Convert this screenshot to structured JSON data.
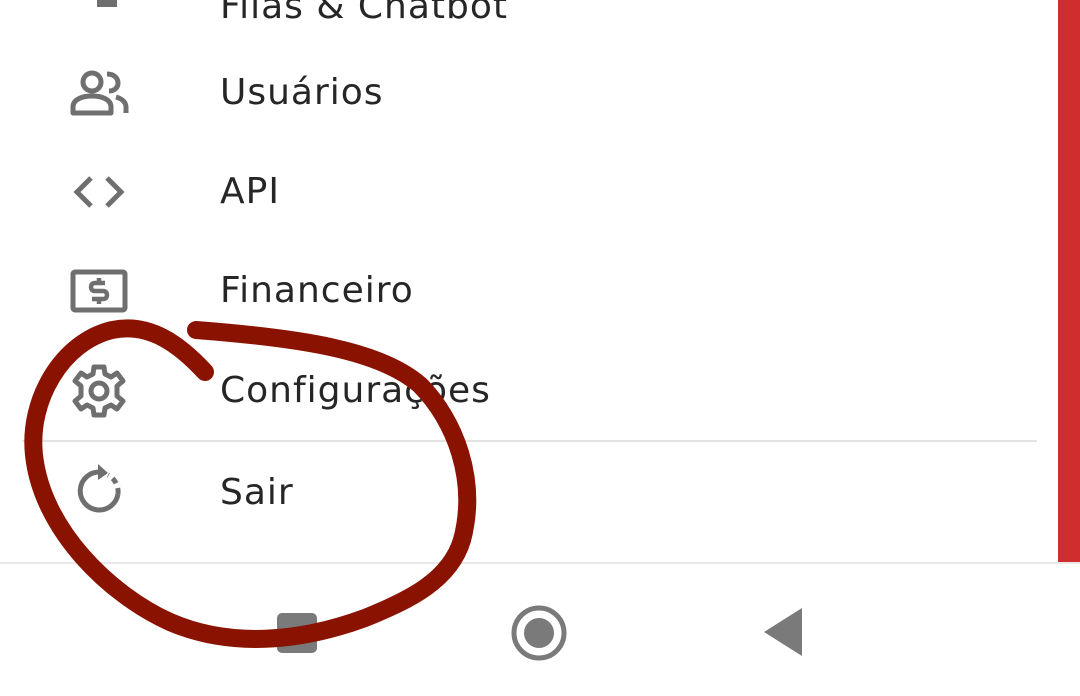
{
  "menu": {
    "items": [
      {
        "id": "filas",
        "label": "Filas & Chatbot",
        "icon": "queue-icon"
      },
      {
        "id": "usuarios",
        "label": "Usuários",
        "icon": "users-icon"
      },
      {
        "id": "api",
        "label": "API",
        "icon": "code-icon"
      },
      {
        "id": "financeiro",
        "label": "Financeiro",
        "icon": "dollar-icon"
      },
      {
        "id": "configuracoes",
        "label": "Configurações",
        "icon": "gear-icon"
      }
    ],
    "logout": {
      "label": "Sair",
      "icon": "refresh-dashed-icon"
    }
  },
  "nav_bar": {
    "buttons": [
      "recents-button",
      "home-button",
      "back-button"
    ]
  },
  "colors": {
    "icon_gray": "#6f6f6f",
    "label_text": "#262626",
    "accent_red_bar": "#d02e2e",
    "annotation_ink": "#8a1200",
    "divider": "#e3e3e3"
  }
}
